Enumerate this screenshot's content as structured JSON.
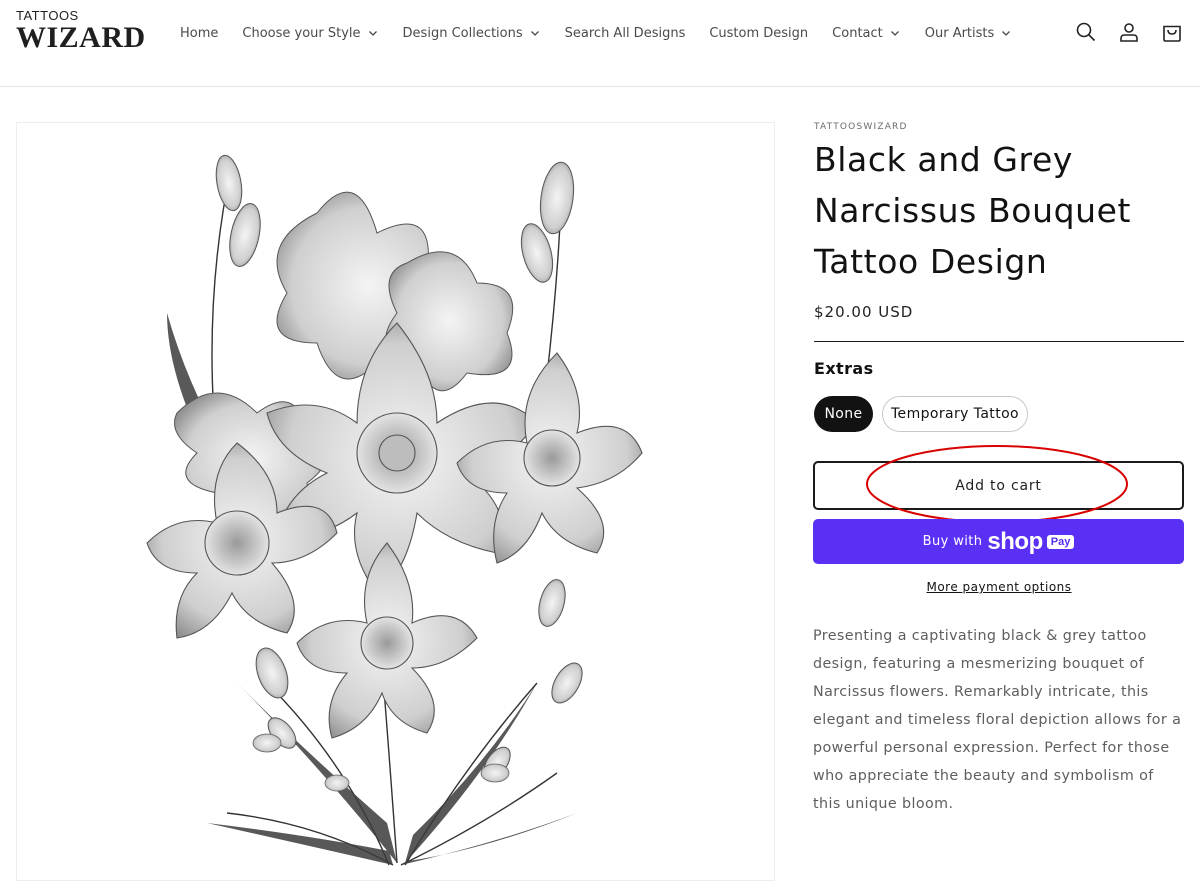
{
  "brand": {
    "top": "TATTOOS",
    "main": "WIZARD"
  },
  "nav": {
    "items": [
      {
        "label": "Home",
        "dropdown": false
      },
      {
        "label": "Choose your Style",
        "dropdown": true
      },
      {
        "label": "Design Collections",
        "dropdown": true
      },
      {
        "label": "Search All Designs",
        "dropdown": false
      },
      {
        "label": "Custom Design",
        "dropdown": false
      },
      {
        "label": "Contact",
        "dropdown": true
      },
      {
        "label": "Our Artists",
        "dropdown": true
      }
    ]
  },
  "header_icons": [
    "search-icon",
    "account-icon",
    "cart-icon"
  ],
  "product": {
    "vendor": "TATTOOSWIZARD",
    "title": "Black and Grey Narcissus Bouquet Tattoo Design",
    "price": "$20.00 USD",
    "extras_label": "Extras",
    "options": [
      {
        "label": "None",
        "selected": true
      },
      {
        "label": "Temporary Tattoo",
        "selected": false
      }
    ],
    "add_to_cart": "Add to cart",
    "buy_with": "Buy with",
    "shop_word": "shop",
    "pay_word": "Pay",
    "more_payment": "More payment options",
    "description": "Presenting a captivating black & grey tattoo design, featuring a mesmerizing bouquet of Narcissus flowers. Remarkably intricate, this elegant and timeless floral depiction allows for a powerful personal expression. Perfect for those who appreciate the beauty and symbolism of this unique bloom."
  },
  "colors": {
    "shop_pay": "#5a31f4",
    "annotation": "#d90000",
    "selected_pill": "#121212"
  }
}
